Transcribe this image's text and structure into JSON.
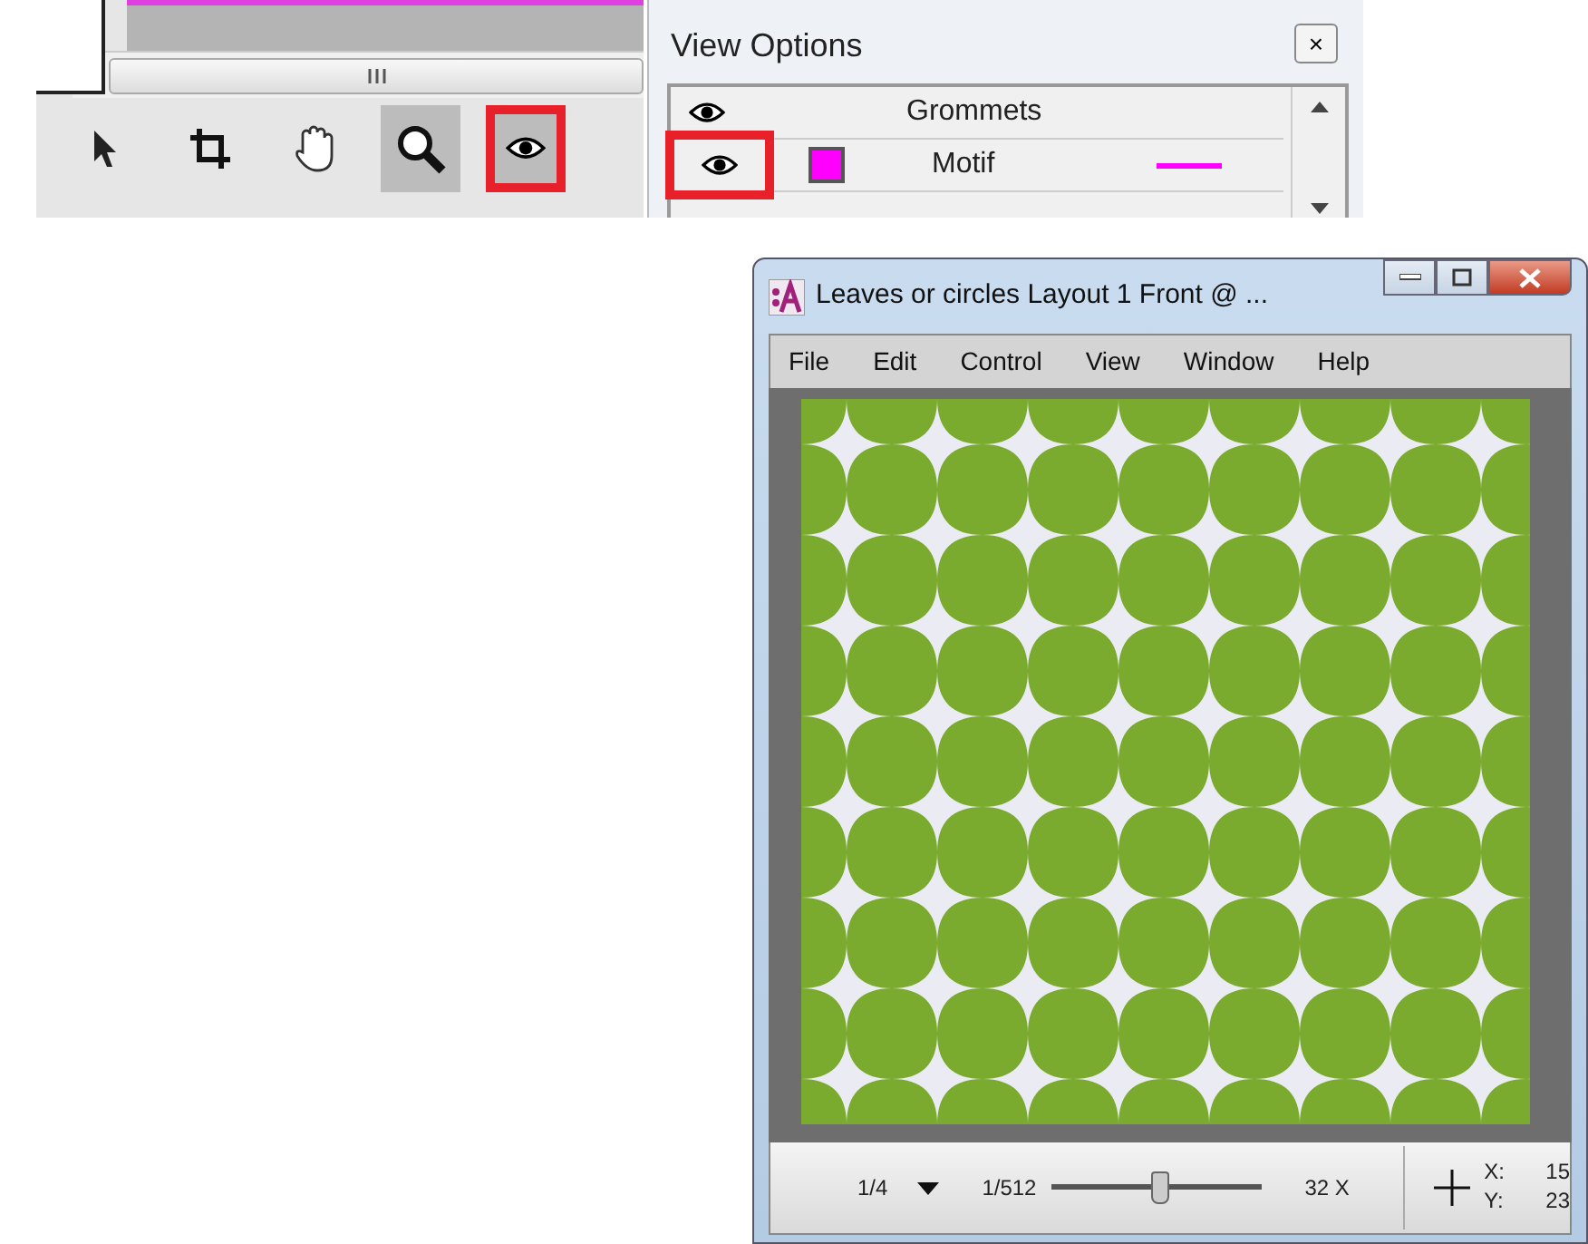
{
  "toolbar": {
    "tools": [
      {
        "kind": "pointer",
        "selected": false,
        "annotated": false
      },
      {
        "kind": "crop",
        "selected": false,
        "annotated": false
      },
      {
        "kind": "hand",
        "selected": false,
        "annotated": false
      },
      {
        "kind": "zoom",
        "selected": true,
        "annotated": false
      },
      {
        "kind": "eye",
        "selected": true,
        "annotated": true
      }
    ]
  },
  "view_options": {
    "title": "View Options",
    "close": "×",
    "rows": [
      {
        "label": "Grommets",
        "visible": true,
        "annotated": false
      },
      {
        "label": "Motif",
        "visible": true,
        "annotated": true,
        "color": "#ff00ff"
      }
    ]
  },
  "window": {
    "title": "Leaves or circles Layout 1 Front @ ...",
    "menu": [
      "File",
      "Edit",
      "Control",
      "View",
      "Window",
      "Help"
    ],
    "status_bar": {
      "page": "1/4",
      "zoom_min": "1/512",
      "level": 0.52,
      "zoom_max": "32 X",
      "x_label": "X:",
      "x_value": "15",
      "y_label": "Y:",
      "y_value": "23"
    }
  }
}
